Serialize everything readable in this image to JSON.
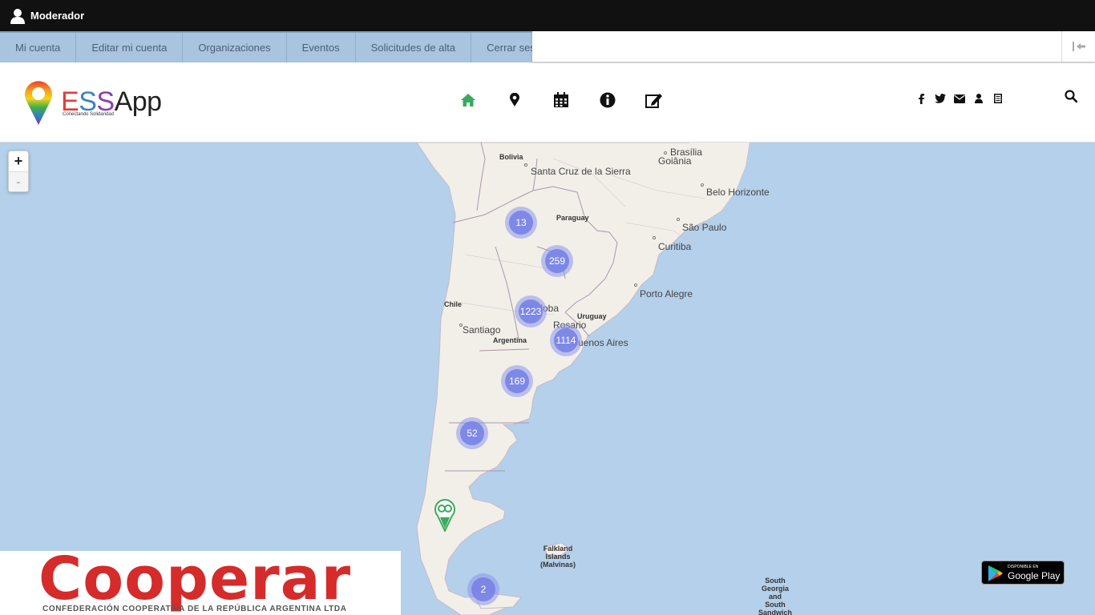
{
  "admin_bar": {
    "user_label": "Moderador"
  },
  "mod_menu": {
    "items": [
      {
        "label": "Mi cuenta"
      },
      {
        "label": "Editar mi cuenta"
      },
      {
        "label": "Organizaciones"
      },
      {
        "label": "Eventos"
      },
      {
        "label": "Solicitudes de alta"
      },
      {
        "label": "Cerrar sesión"
      }
    ]
  },
  "header": {
    "logo": {
      "brand_e": "E",
      "brand_s1": "S",
      "brand_s2": "S",
      "brand_app": "App",
      "tagline": "Conectando Solidaridad"
    },
    "nav_icons": [
      "home-icon",
      "map-marker-icon",
      "calendar-icon",
      "info-circle-icon",
      "edit-icon"
    ],
    "social_icons": [
      "facebook-icon",
      "twitter-icon",
      "envelope-icon",
      "user-icon",
      "document-icon"
    ],
    "accent": "#3aaa5c"
  },
  "map": {
    "zoom_in": "+",
    "zoom_out": "-",
    "labels": {
      "bolivia": "Bolivia",
      "santa_cruz": "Santa Cruz de la Sierra",
      "brasilia": "Brasília",
      "goiania": "Goiânia",
      "belo_horizonte": "Belo Horizonte",
      "paraguay": "Paraguay",
      "sao_paulo": "São Paulo",
      "curitiba": "Curitiba",
      "porto_alegre": "Porto Alegre",
      "chile": "Chile",
      "cordoba": "Córdoba",
      "uruguay": "Uruguay",
      "rosario": "Rosario",
      "santiago": "Santiago",
      "buenos_aires": "Buenos Aires",
      "argentina": "Argentina",
      "falkland": "Falkland\nIslands\n(Malvinas)",
      "south_georgia": "South\nGeorgia\nand\nSouth\nSandwich"
    },
    "clusters": [
      {
        "count": "13"
      },
      {
        "count": "259"
      },
      {
        "count": "1223"
      },
      {
        "count": "1114"
      },
      {
        "count": "169"
      },
      {
        "count": "52"
      },
      {
        "count": "2"
      }
    ],
    "cluster_color": "#7882e6",
    "marker_color": "#3aaa5c"
  },
  "sponsor": {
    "name": "Cooperar",
    "subtitle": "CONFEDERACIÓN COOPERATIVA DE LA REPÚBLICA ARGENTINA LTDA",
    "color": "#d52b2b"
  },
  "google_play": {
    "small": "DISPONIBLE EN",
    "big": "Google Play"
  }
}
